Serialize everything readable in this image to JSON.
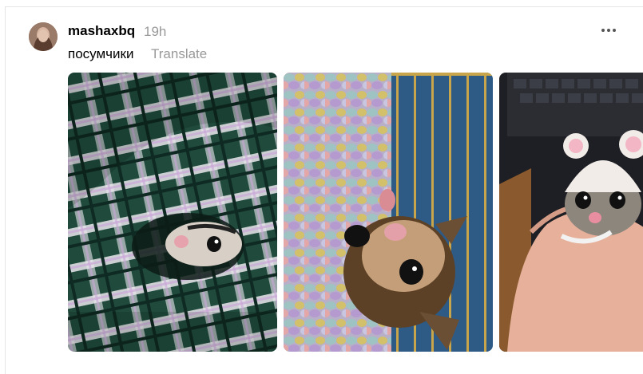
{
  "post": {
    "username": "mashaxbq",
    "time": "19h",
    "caption": "посумчики",
    "translate_label": "Translate"
  },
  "icons": {
    "more": "more-horizontal-icon"
  },
  "colors": {
    "muted_text": "#999999",
    "border": "#e5e5e5"
  }
}
